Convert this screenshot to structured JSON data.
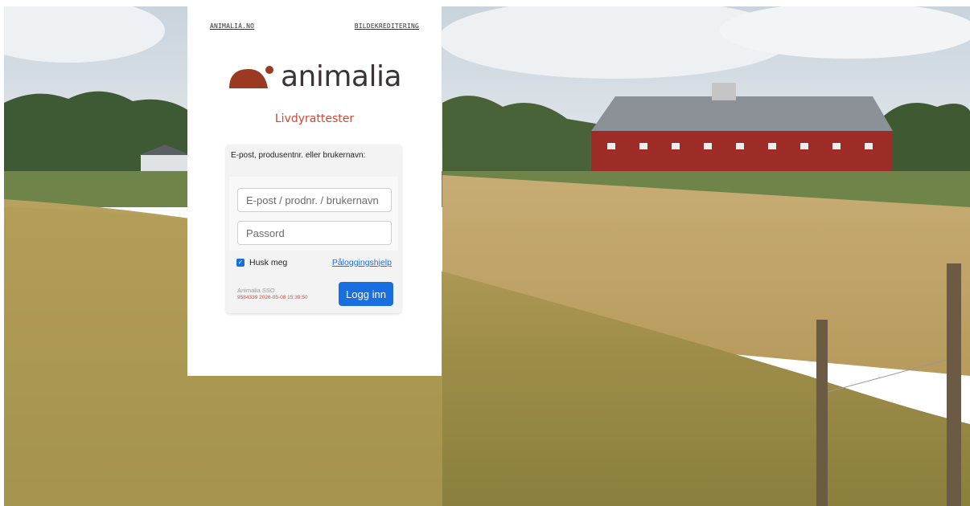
{
  "top_links": {
    "left": "ANIMALIA.NO",
    "right": "BILDEKREDITERING"
  },
  "brand": {
    "name": "animalia",
    "subtitle": "Livdyrattester",
    "logo_icon": "animalia-logo-mark",
    "accent_color": "#9b3a22",
    "subtitle_color": "#d6452f"
  },
  "form": {
    "label": "E-post, produsentnr. eller brukernavn:",
    "username_placeholder": "E-post / prodnr. / brukernavn",
    "username_value": "",
    "password_placeholder": "Passord",
    "password_value": "",
    "remember_label": "Husk meg",
    "remember_checked": true,
    "help_link": "Påloggingshjelp",
    "submit_label": "Logg inn",
    "submit_color": "#1a6fe0"
  },
  "footer": {
    "sso_name": "Animalia SSO",
    "build_stamp": "9584339 2026-05-08 15:39:50"
  }
}
